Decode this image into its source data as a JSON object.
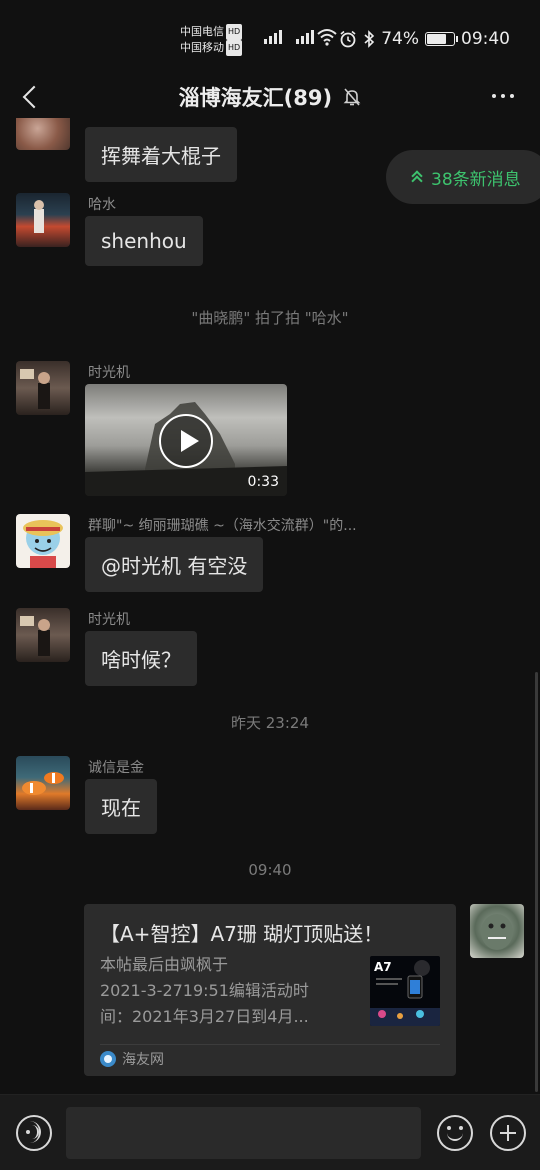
{
  "status_bar": {
    "carrier1": "中国电信",
    "carrier2": "中国移动",
    "hd": "HD",
    "net1": "4G",
    "net2": "5G",
    "battery_text": "74%",
    "battery_level": 0.74,
    "time": "09:40",
    "icons": [
      "alarm-icon",
      "bluetooth-icon",
      "wifi-icon",
      "signal-icon",
      "battery-icon"
    ]
  },
  "header": {
    "title": "淄博海友汇(89)",
    "icons": [
      "back-arrow-icon",
      "mute-bell-icon",
      "more-dots-icon"
    ]
  },
  "new_messages": {
    "label": "38条新消息"
  },
  "messages": {
    "m0": {
      "text": "挥舞着大棍子"
    },
    "m1": {
      "sender": "哈水",
      "text": "shenhou"
    },
    "pat": "\"曲晓鹏\" 拍了拍 \"哈水\"",
    "m2": {
      "sender": "时光机",
      "video_duration": "0:33"
    },
    "m3": {
      "sender": "群聊\"~ 绚丽珊瑚礁 ~（海水交流群）\"的...",
      "text": "@时光机  有空没"
    },
    "m4": {
      "sender": "时光机",
      "text": "啥时候？"
    },
    "time1": "昨天 23:24",
    "m5": {
      "sender": "诚信是金",
      "text": "现在"
    },
    "time2": "09:40",
    "card": {
      "title": "【A+智控】A7珊 瑚灯顶贴送！",
      "desc_line1": "本帖最后由飒枫于",
      "desc_line2": "2021-3-2719:51编辑活动时",
      "desc_line3": "间：2021年3月27日到4月...",
      "thumb_label": "A7",
      "source": "海友网"
    }
  },
  "input_bar": {
    "icons": [
      "voice-icon",
      "emoji-icon",
      "plus-icon"
    ],
    "input_value": ""
  },
  "colors": {
    "background": "#111111",
    "bubble": "#2c2c2c",
    "accent_green": "#3dc36e"
  }
}
